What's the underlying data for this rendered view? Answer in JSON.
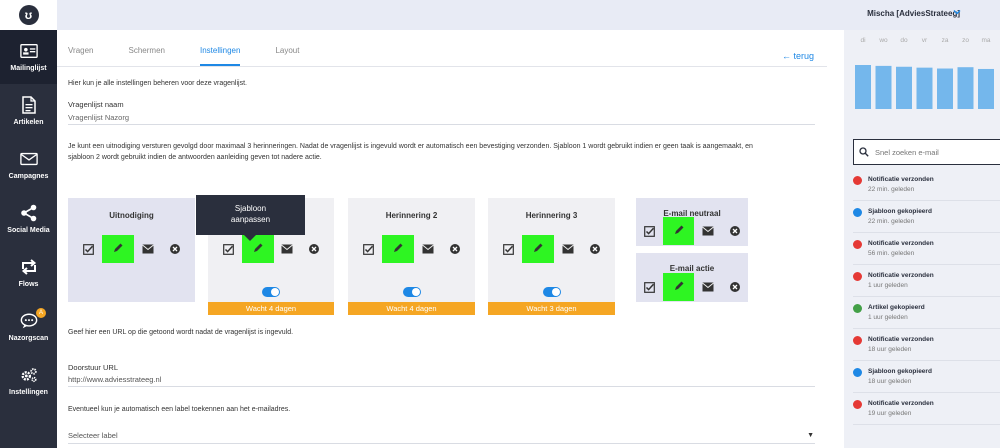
{
  "user": {
    "name": "Mischa [AdviesStrateeg]"
  },
  "logo": {
    "glyph": "ʊ"
  },
  "nav": [
    {
      "label": "Mailinglijst",
      "icon": "address-card-icon"
    },
    {
      "label": "Artikelen",
      "icon": "document-icon"
    },
    {
      "label": "Campagnes",
      "icon": "envelope-icon"
    },
    {
      "label": "Social Media",
      "icon": "share-icon"
    },
    {
      "label": "Flows",
      "icon": "flow-arrows-icon"
    },
    {
      "label": "Nazorgscan",
      "icon": "chat-bubble-icon",
      "badge": "A"
    },
    {
      "label": "Instellingen",
      "icon": "gears-icon"
    }
  ],
  "tabs": [
    "Vragen",
    "Schermen",
    "Instellingen",
    "Layout"
  ],
  "active_tab": "Instellingen",
  "back_label": "← terug",
  "intro": "Hier kun je alle instellingen beheren voor deze vragenlijst.",
  "name_field": {
    "label": "Vragenlijst naam",
    "value": "Vragenlijst Nazorg"
  },
  "description": {
    "line1": "Je kunt een uitnodiging versturen gevolgd door maximaal 3 herinneringen. Nadat de vragenlijst is ingevuld wordt er automatisch een bevestiging verzonden. Sjabloon 1 wordt gebruikt indien er geen taak is aangemaakt, en",
    "line2": "sjabloon 2 wordt gebruikt indien de antwoorden aanleiding geven tot nadere actie."
  },
  "templates": [
    {
      "title": "Uitnodiging"
    },
    {
      "title": ""
    },
    {
      "title": "Herinnering 2",
      "wait": "Wacht 4 dagen"
    },
    {
      "title": "Herinnering 3",
      "wait": "Wacht 3 dagen"
    },
    {
      "title": "E-mail neutraal"
    },
    {
      "title": "E-mail actie"
    }
  ],
  "template1_wait": "Wacht 4 dagen",
  "tooltip": {
    "line1": "Sjabloon",
    "line2": "aanpassen"
  },
  "redirect_intro": "Geef hier een URL op die getoond wordt nadat de vragenlijst is ingevuld.",
  "redirect_field": {
    "label": "Doorstuur URL",
    "value": "http://www.adviesstrateeg.nl"
  },
  "label_intro": "Eventueel kun je automatisch een label toekennen aan het e-mailadres.",
  "label_select": {
    "placeholder": "Selecteer label"
  },
  "chart_data": {
    "type": "bar",
    "categories": [
      "di",
      "wo",
      "do",
      "vr",
      "za",
      "zo",
      "ma"
    ],
    "values": [
      100,
      98,
      96,
      94,
      92,
      95,
      91
    ],
    "ylim": [
      0,
      100
    ],
    "title": "",
    "xlabel": "",
    "ylabel": "",
    "grid": false,
    "colors": {
      "bar": "#74b7ec"
    }
  },
  "search": {
    "placeholder": "Snel zoeken e-mail"
  },
  "activity": [
    {
      "title": "Notificatie verzonden",
      "time": "22 min. geleden",
      "color": "#e53935",
      "icon": "notification-icon"
    },
    {
      "title": "Sjabloon gekopieerd",
      "time": "22 min. geleden",
      "color": "#1e88e5",
      "icon": "copy-icon"
    },
    {
      "title": "Notificatie verzonden",
      "time": "56 min. geleden",
      "color": "#e53935",
      "icon": "notification-icon"
    },
    {
      "title": "Notificatie verzonden",
      "time": "1 uur geleden",
      "color": "#e53935",
      "icon": "notification-icon"
    },
    {
      "title": "Artikel gekopieerd",
      "time": "1 uur geleden",
      "color": "#43a047",
      "icon": "article-icon"
    },
    {
      "title": "Notificatie verzonden",
      "time": "18 uur geleden",
      "color": "#e53935",
      "icon": "notification-icon"
    },
    {
      "title": "Sjabloon gekopieerd",
      "time": "18 uur geleden",
      "color": "#1e88e5",
      "icon": "copy-icon"
    },
    {
      "title": "Notificatie verzonden",
      "time": "19 uur geleden",
      "color": "#e53935",
      "icon": "notification-icon"
    }
  ],
  "colors": {
    "accent": "#1e88e5",
    "sidebar": "#2a2f3d",
    "wait": "#f5a623",
    "highlight": "#2ef522"
  }
}
